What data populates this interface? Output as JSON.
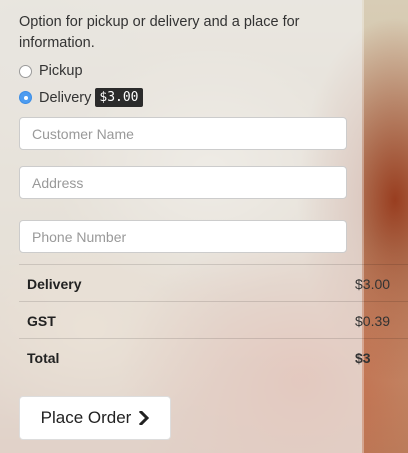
{
  "form": {
    "info_text": "Option for pickup or delivery and a place for information.",
    "options": [
      {
        "label": "Pickup",
        "selected": false
      },
      {
        "label": "Delivery",
        "selected": true,
        "price": "$3.00"
      }
    ],
    "fields": {
      "customer_name": {
        "placeholder": "Customer Name",
        "value": ""
      },
      "address": {
        "placeholder": "Address",
        "value": ""
      },
      "phone": {
        "placeholder": "Phone Number",
        "value": ""
      }
    }
  },
  "summary": {
    "rows": [
      {
        "label": "Delivery",
        "amount": "$3.00"
      },
      {
        "label": "GST",
        "amount": "$0.39"
      },
      {
        "label": "Total",
        "amount": "$3"
      }
    ]
  },
  "order_button": {
    "label": "Place Order",
    "icon": "chevron-right-icon"
  },
  "colors": {
    "radio_selected": "#4d9cf0",
    "price_tag_bg": "#2b2b2b"
  }
}
